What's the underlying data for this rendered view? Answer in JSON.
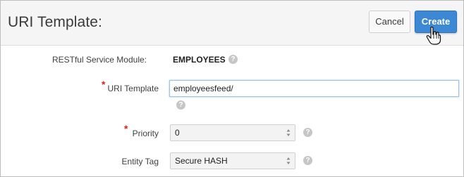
{
  "header": {
    "title": "URI Template:",
    "cancel_label": "Cancel",
    "create_label": "Create"
  },
  "form": {
    "module": {
      "label": "RESTful Service Module:",
      "value": "EMPLOYEES"
    },
    "uri_template": {
      "label": "URI Template",
      "value": "employeesfeed/",
      "required": true
    },
    "priority": {
      "label": "Priority",
      "value": "0",
      "required": true
    },
    "entity_tag": {
      "label": "Entity Tag",
      "value": "Secure HASH"
    }
  },
  "help_glyph": "?",
  "required_glyph": "*",
  "colors": {
    "accent": "#3c88d4",
    "required": "#e02020"
  }
}
